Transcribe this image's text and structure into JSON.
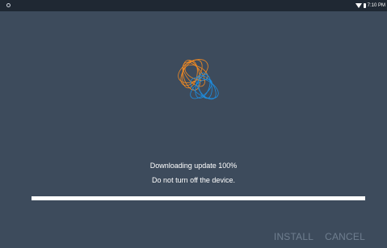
{
  "status_bar": {
    "time": "7:10 PM",
    "icons": [
      "android-system-icon",
      "wifi-icon",
      "battery-icon"
    ]
  },
  "dialog": {
    "logo_icon": "spiral-sphere-logo-icon",
    "progress_text": "Downloading update 100%",
    "warning_text": "Do not turn off the device.",
    "progress_percent": 100,
    "install_label": "INSTALL",
    "cancel_label": "CANCEL"
  },
  "colors": {
    "background": "#3d4b5c",
    "status_bar": "#1f2833",
    "progress_fill": "#ffffff",
    "button_disabled": "#6f7e8f",
    "logo_orange": "#f28a22",
    "logo_blue": "#1d8de0"
  }
}
